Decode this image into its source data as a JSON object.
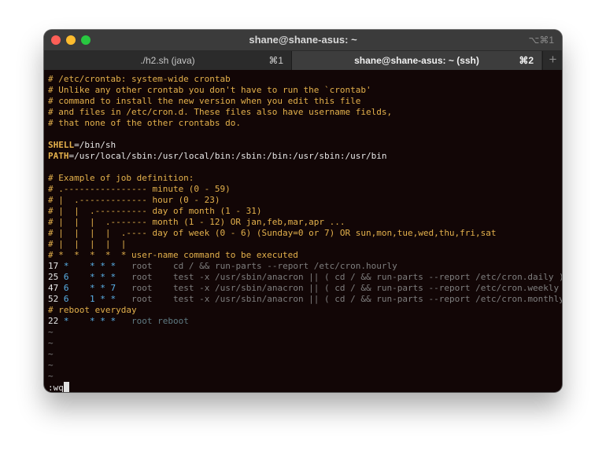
{
  "window": {
    "title": "shane@shane-asus: ~",
    "shortcut": "⌥⌘1"
  },
  "tabs": [
    {
      "label": "./h2.sh (java)",
      "key": "⌘1"
    },
    {
      "label": "shane@shane-asus: ~ (ssh)",
      "key": "⌘2"
    }
  ],
  "new_tab_icon": "+",
  "lines": [
    "# /etc/crontab: system-wide crontab",
    "# Unlike any other crontab you don't have to run the `crontab'",
    "# command to install the new version when you edit this file",
    "# and files in /etc/cron.d. These files also have username fields,",
    "# that none of the other crontabs do.",
    "",
    "SHELL=/bin/sh",
    "PATH=/usr/local/sbin:/usr/local/bin:/sbin:/bin:/usr/sbin:/usr/bin",
    "",
    "# Example of job definition:",
    "# .---------------- minute (0 - 59)",
    "# |  .------------- hour (0 - 23)",
    "# |  |  .---------- day of month (1 - 31)",
    "# |  |  |  .------- month (1 - 12) OR jan,feb,mar,apr ...",
    "# |  |  |  |  .---- day of week (0 - 6) (Sunday=0 or 7) OR sun,mon,tue,wed,thu,fri,sat",
    "# |  |  |  |  |",
    "# *  *  *  *  * user-name command to be executed"
  ],
  "jobs": [
    {
      "minute": "17",
      "hour": "*",
      "dom": "*",
      "month": "*",
      "dow": "*",
      "user": "root",
      "command": "cd / && run-parts --report /etc/cron.hourly"
    },
    {
      "minute": "25",
      "hour": "6",
      "dom": "*",
      "month": "*",
      "dow": "*",
      "user": "root",
      "command": "test -x /usr/sbin/anacron || ( cd / && run-parts --report /etc/cron.daily )"
    },
    {
      "minute": "47",
      "hour": "6",
      "dom": "*",
      "month": "*",
      "dow": "7",
      "user": "root",
      "command": "test -x /usr/sbin/anacron || ( cd / && run-parts --report /etc/cron.weekly )"
    },
    {
      "minute": "52",
      "hour": "6",
      "dom": "1",
      "month": "*",
      "dow": "*",
      "user": "root",
      "command": "test -x /usr/sbin/anacron || ( cd / && run-parts --report /etc/cron.monthly )"
    }
  ],
  "reboot_comment": "# reboot everyday",
  "reboot_job": {
    "minute": "22",
    "hour": "*",
    "dom": "*",
    "month": "*",
    "dow": "*",
    "user": "root",
    "command": "reboot"
  },
  "tilde_lines": [
    "~",
    "~",
    "~",
    "~",
    "~"
  ],
  "command_line": ":wq"
}
